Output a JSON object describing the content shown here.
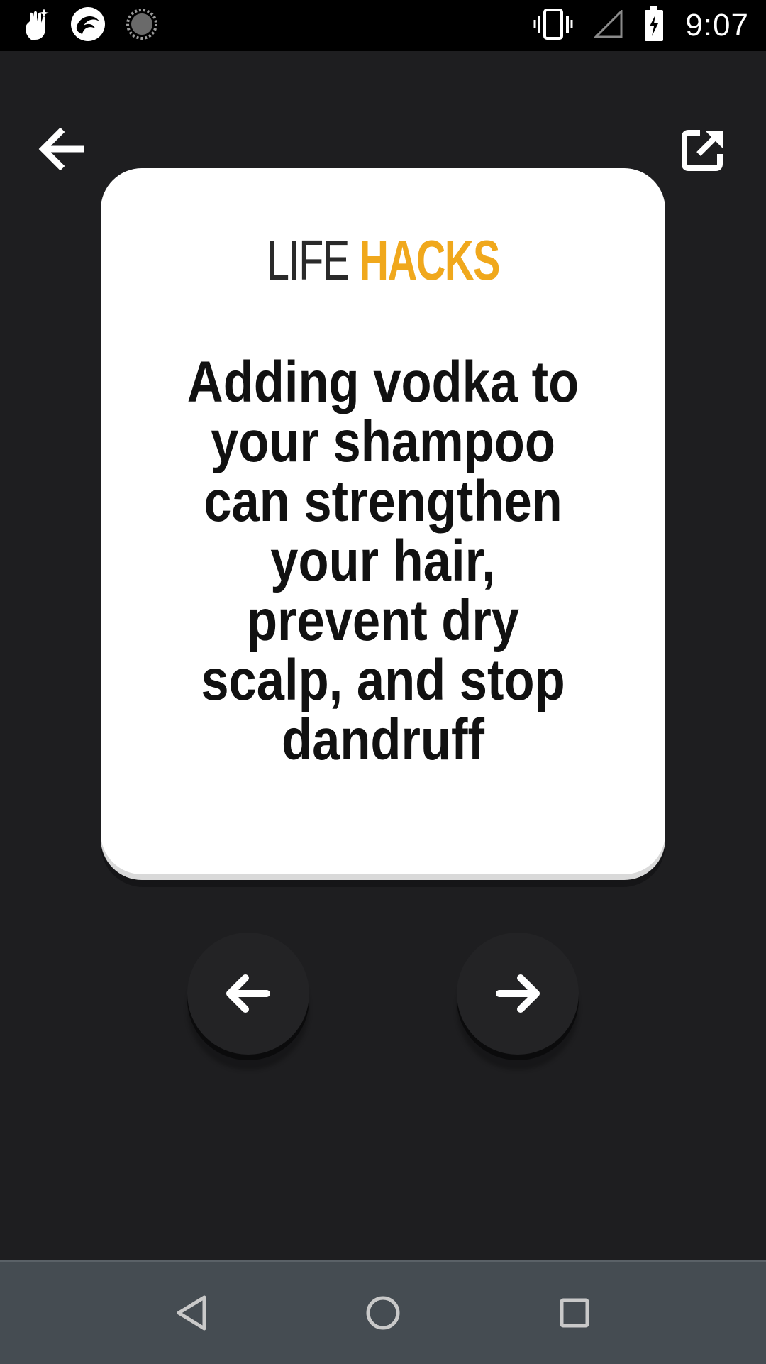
{
  "status_bar": {
    "time": "9:07",
    "icons": [
      "hand-sparkle-icon",
      "app-circle-icon",
      "loading-circle-icon",
      "vibrate-icon",
      "signal-icon",
      "battery-charging-icon"
    ]
  },
  "toolbar": {
    "back_icon": "arrow-left-icon",
    "share_icon": "share-external-icon"
  },
  "card": {
    "title_part1": "LIFE",
    "title_part2": "HACKS",
    "text": "Adding vodka to your shampoo can strengthen your hair, prevent dry scalp, and stop dandruff"
  },
  "navigation": {
    "prev_icon": "arrow-left-icon",
    "next_icon": "arrow-right-icon"
  },
  "system_nav": {
    "icons": [
      "triangle-back-icon",
      "circle-home-icon",
      "square-recents-icon"
    ]
  },
  "colors": {
    "background": "#1e1e20",
    "card": "#ffffff",
    "accent": "#f0a81c",
    "system_nav": "#454c52"
  }
}
